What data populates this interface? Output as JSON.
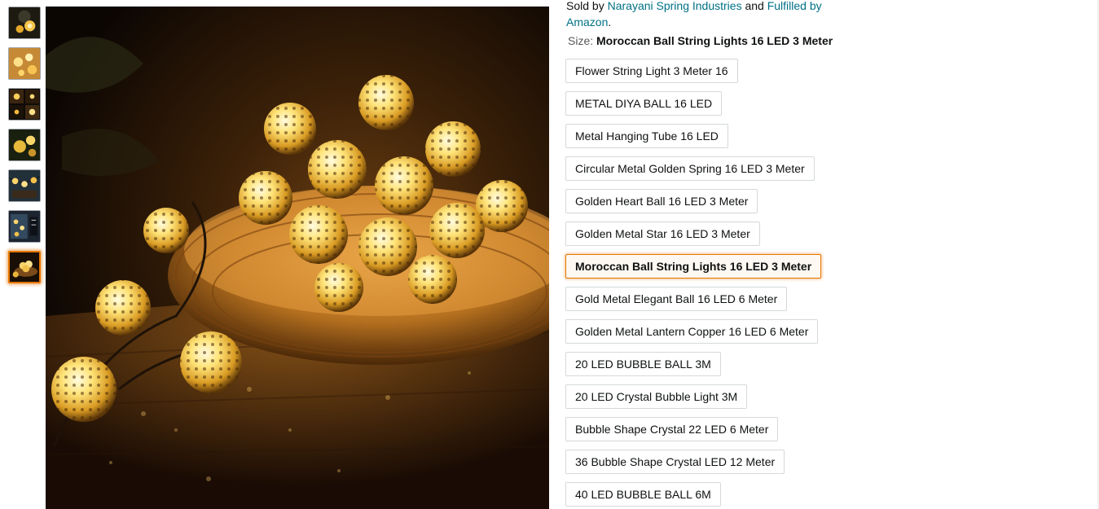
{
  "thumbnails": [
    {
      "icon": "lantern-lights-thumbnail"
    },
    {
      "icon": "star-lights-thumbnail"
    },
    {
      "icon": "lights-collage-thumbnail"
    },
    {
      "icon": "lantern-closeup-thumbnail"
    },
    {
      "icon": "hanging-lights-thumbnail"
    },
    {
      "icon": "lights-dimensions-thumbnail"
    },
    {
      "icon": "moroccan-ball-lights-thumbnail",
      "active": true
    }
  ],
  "main_image": {
    "icon": "moroccan-ball-string-lights-photo"
  },
  "seller": {
    "prefix": "Sold by ",
    "seller_name": "Narayani Spring Industries",
    "and": " and ",
    "fulfilled": "Fulfilled by",
    "fulfilled_by": "Amazon",
    "period": "."
  },
  "size": {
    "label": "Size: ",
    "selected": "Moroccan Ball String Lights 16 LED 3 Meter"
  },
  "variants": [
    "Flower String Light 3 Meter 16",
    "METAL DIYA BALL 16 LED",
    "Metal Hanging Tube 16 LED",
    "Circular Metal Golden Spring 16 LED 3 Meter",
    "Golden Heart Ball 16 LED 3 Meter",
    "Golden Metal Star 16 LED 3 Meter",
    "Moroccan Ball String Lights 16 LED 3 Meter",
    "Gold Metal Elegant Ball 16 LED 6 Meter",
    "Golden Metal Lantern Copper 16 LED 6 Meter",
    "20 LED BUBBLE BALL 3M",
    "20 LED Crystal Bubble Light 3M",
    "Bubble Shape Crystal 22 LED 6 Meter",
    "36 Bubble Shape Crystal LED 12 Meter",
    "40 LED BUBBLE BALL 6M"
  ],
  "selected_variant_index": 6,
  "colors": {
    "link": "#007185",
    "selected_border": "#e77600",
    "text": "#0f1111",
    "muted": "#565959"
  }
}
